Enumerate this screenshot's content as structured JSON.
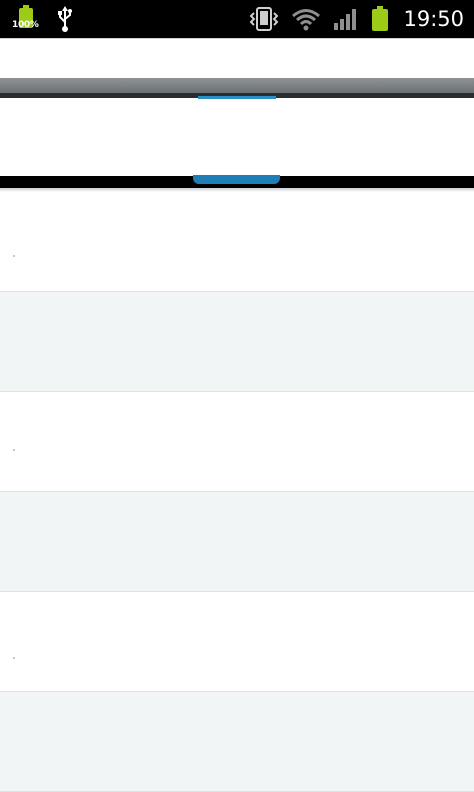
{
  "status_bar": {
    "battery_percent_label": "100%",
    "time": "19:50",
    "icons": [
      "battery-icon",
      "usb-icon",
      "vibrate-icon",
      "wifi-icon",
      "signal-icon",
      "battery-full-icon"
    ],
    "accent_color": "#9ccc17"
  },
  "tabs": {
    "selected_indicator_color": "#1e7fb6"
  },
  "list": {
    "items": [
      {
        "id": 1,
        "background": "#ffffff"
      },
      {
        "id": 2,
        "background": "#f1f5f6"
      },
      {
        "id": 3,
        "background": "#ffffff"
      },
      {
        "id": 4,
        "background": "#f1f5f6"
      },
      {
        "id": 5,
        "background": "#ffffff"
      },
      {
        "id": 6,
        "background": "#f1f5f6"
      }
    ]
  }
}
